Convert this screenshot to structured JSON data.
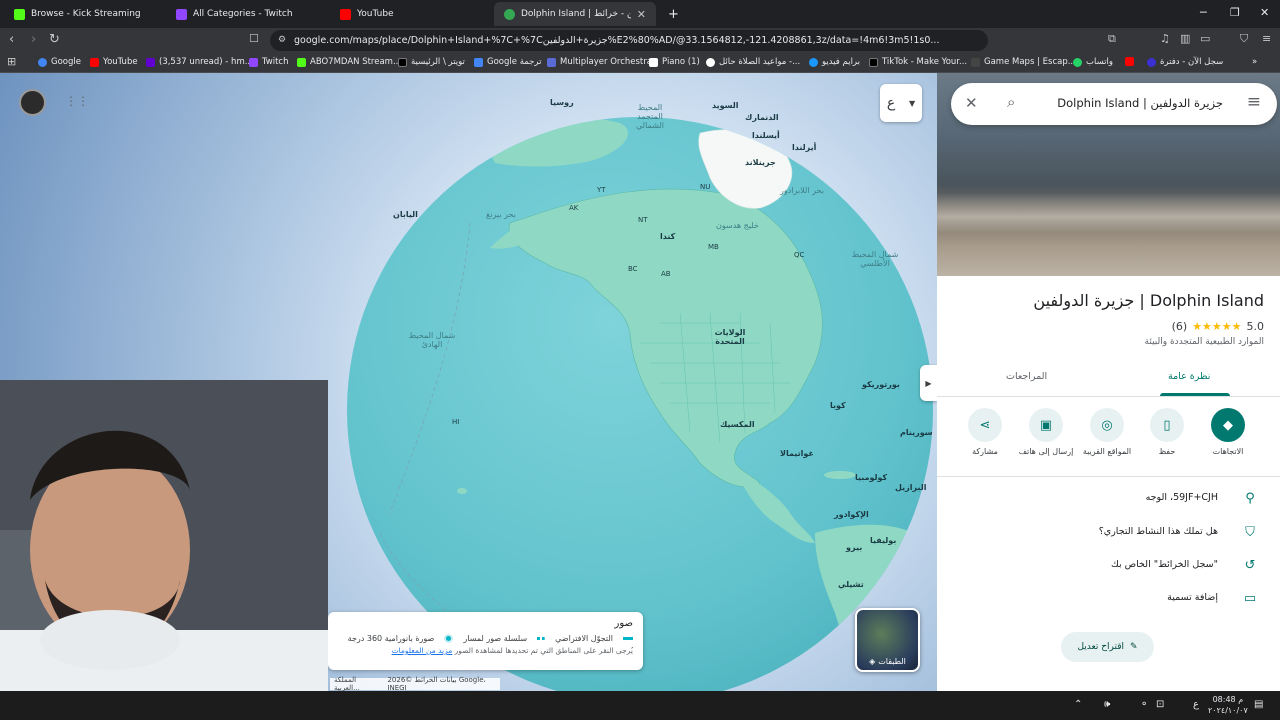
{
  "tabs": [
    {
      "title": "Browse - Kick Streaming",
      "favicon_color": "#53fc18",
      "icon": "kick-icon"
    },
    {
      "title": "All Categories - Twitch",
      "favicon_color": "#9146ff",
      "icon": "twitch-icon"
    },
    {
      "title": "YouTube",
      "favicon_color": "#ff0000",
      "icon": "youtube-icon"
    },
    {
      "title": "Dolphin Island | جزيرة الدولفين - خرائط",
      "favicon_color": "#34a853",
      "icon": "maps-icon",
      "active": true
    }
  ],
  "new_tab_label": "+",
  "url": "google.com/maps/place/Dolphin+Island+%7C+%7Cجزيرة+الدولفين%E2%80%AD/@33.1564812,-121.4208861,3z/data=!4m6!3m5!1s0...",
  "bookmarks": [
    {
      "label": "Google",
      "color": "#4285f4"
    },
    {
      "label": "YouTube",
      "color": "#ff0000"
    },
    {
      "label": "(3,537 unread) - hm...",
      "color": "#6001d2"
    },
    {
      "label": "Twitch",
      "color": "#9146ff"
    },
    {
      "label": "ABO7MDAN Stream...",
      "color": "#53fc18"
    },
    {
      "label": "تويتر \\ الرئيسية",
      "color": "#000000"
    },
    {
      "label": "Google ترجمة",
      "color": "#4285f4"
    },
    {
      "label": "Multiplayer Orchestra",
      "color": "#5b6bd6"
    },
    {
      "label": "Piano (1)",
      "color": "#ffffff"
    },
    {
      "label": "مواعيد الصلاة حائل -...",
      "color": "#ffffff"
    },
    {
      "label": "برايم فيديو",
      "color": "#1a98ff"
    },
    {
      "label": "TikTok - Make Your...",
      "color": "#000000"
    },
    {
      "label": "Game Maps | Escap...",
      "color": "#444444"
    },
    {
      "label": "واتساب",
      "color": "#25d366"
    },
    {
      "label": "سجل الآن - دفترة",
      "color": "#3b30d1"
    }
  ],
  "bookmarks_more": "»",
  "globe_labels": [
    {
      "text": "روسيا",
      "sea": false
    },
    {
      "text": "السويد",
      "sea": false
    },
    {
      "text": "الدنمارك",
      "sea": false
    },
    {
      "text": "أيسلندا",
      "sea": false
    },
    {
      "text": "أيرلندا",
      "sea": false
    },
    {
      "text": "جرينلاند",
      "sea": false
    },
    {
      "text": "اليابان",
      "sea": false
    },
    {
      "text": "كندا",
      "sea": false
    },
    {
      "text": "الولايات المتحدة",
      "sea": false
    },
    {
      "text": "المكسيك",
      "sea": false
    },
    {
      "text": "كوبا",
      "sea": false
    },
    {
      "text": "بورتوريكو",
      "sea": false
    },
    {
      "text": "غواتيمالا",
      "sea": false
    },
    {
      "text": "كولومبيا",
      "sea": false
    },
    {
      "text": "الإكوادور",
      "sea": false
    },
    {
      "text": "البرازيل",
      "sea": false
    },
    {
      "text": "سورينام",
      "sea": false
    },
    {
      "text": "بيرو",
      "sea": false
    },
    {
      "text": "بوليفيا",
      "sea": false
    },
    {
      "text": "تشيلي",
      "sea": false
    },
    {
      "text": "المحيط المتجمد الشمالي",
      "sea": true
    },
    {
      "text": "بحر بيرنغ",
      "sea": true
    },
    {
      "text": "خليج هدسون",
      "sea": true
    },
    {
      "text": "بحر اللابرادور",
      "sea": true
    },
    {
      "text": "شمال المحيط الأطلسي",
      "sea": true
    },
    {
      "text": "شمال المحيط الهادئ",
      "sea": true
    },
    {
      "text": "HI",
      "sea": false
    },
    {
      "text": "AK",
      "sea": false
    },
    {
      "text": "NT",
      "sea": false
    },
    {
      "text": "NU",
      "sea": false
    },
    {
      "text": "BC",
      "sea": false
    },
    {
      "text": "AB",
      "sea": false
    },
    {
      "text": "MB",
      "sea": false
    },
    {
      "text": "QC",
      "sea": false
    },
    {
      "text": "YT",
      "sea": false
    }
  ],
  "map_controls": {
    "apps_icon": "apps-grid-icon",
    "language_button_label": "ع",
    "layers_label": "الطبقات",
    "collapse_icon": "chevron-right-icon"
  },
  "legend": {
    "title": "صور",
    "items": [
      {
        "label": "التجوّل الافتراضي",
        "swatch": "#00b5c7"
      },
      {
        "label": "سلسلة صور لمسار",
        "swatch": "#00b5c7"
      },
      {
        "label": "صورة بانورامية 360 درجة",
        "swatch": "#00b5c7"
      }
    ],
    "note": "يُرجى النقر على المناطق التي تم تحديدها لمشاهدة الصور",
    "more_link": "مزيد من المعلومات"
  },
  "map_footer": {
    "attribution": "بيانات الخرائط ©2026 Google، INEGI",
    "region": "المملكة العربية..."
  },
  "panel": {
    "search_text": "Dolphin Island | جزيرة الدولفين",
    "place_title": "Dolphin Island | جزيرة الدولفين",
    "rating_value": "5.0",
    "stars": "★★★★★",
    "review_count": "(6)",
    "category": "الموارد الطبيعية المتجددة والبيئة",
    "tabs": [
      {
        "label": "نظرة عامة",
        "active": true
      },
      {
        "label": "المراجعات",
        "active": false
      }
    ],
    "actions": [
      {
        "label": "الاتجاهات",
        "icon": "directions-icon",
        "primary": true
      },
      {
        "label": "حفظ",
        "icon": "bookmark-icon",
        "primary": false
      },
      {
        "label": "المواقع القريبة",
        "icon": "nearby-icon",
        "primary": false
      },
      {
        "label": "إرسال إلى هاتف",
        "icon": "send-to-phone-icon",
        "primary": false
      },
      {
        "label": "مشاركة",
        "icon": "share-icon",
        "primary": false
      }
    ],
    "info": [
      {
        "text": "59JF+CJH، الوجه",
        "icon": "location-pin-icon"
      },
      {
        "text": "هل تملك هذا النشاط التجاري؟",
        "icon": "verified-shield-icon"
      },
      {
        "text": "\"سجل الخرائط\" الخاص بك",
        "icon": "history-icon"
      },
      {
        "text": "إضافة تسمية",
        "icon": "label-icon"
      }
    ],
    "suggest_edit": "اقتراح تعديل"
  },
  "taskbar": {
    "time": "08:48 م",
    "date": "٢٠٢٤/١٠/٠٧",
    "lang": "ع"
  },
  "colors": {
    "accent": "#01796f",
    "star": "#fbbc04",
    "land": "#8fd9c4",
    "ocean": "#6cc7cf"
  }
}
